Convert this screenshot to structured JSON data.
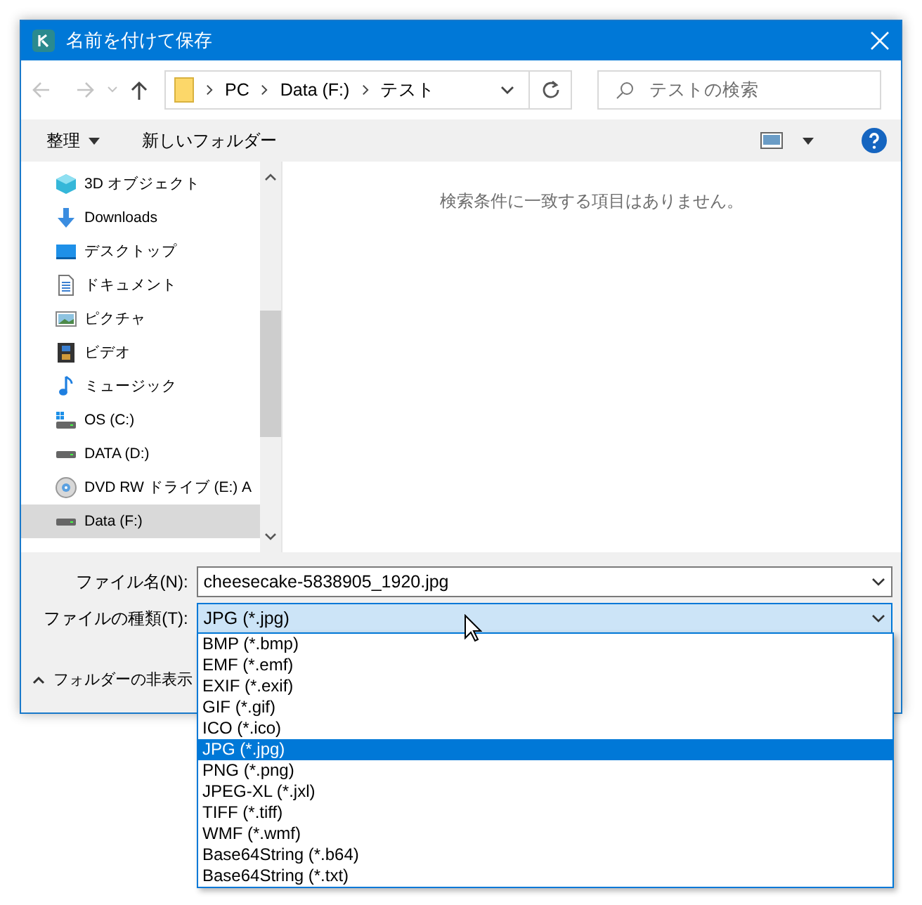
{
  "window": {
    "title": "名前を付けて保存"
  },
  "address": {
    "path": [
      {
        "label": "PC"
      },
      {
        "label": "Data (F:)"
      },
      {
        "label": "テスト"
      }
    ]
  },
  "search": {
    "placeholder": "テストの検索"
  },
  "toolbar": {
    "organize": "整理",
    "new_folder": "新しいフォルダー"
  },
  "sidebar": {
    "items": [
      {
        "label": "3D オブジェクト",
        "kind": "objects",
        "selected": false
      },
      {
        "label": "Downloads",
        "kind": "downloads",
        "selected": false
      },
      {
        "label": "デスクトップ",
        "kind": "desktop",
        "selected": false
      },
      {
        "label": "ドキュメント",
        "kind": "documents",
        "selected": false
      },
      {
        "label": "ピクチャ",
        "kind": "pictures",
        "selected": false
      },
      {
        "label": "ビデオ",
        "kind": "videos",
        "selected": false
      },
      {
        "label": "ミュージック",
        "kind": "music",
        "selected": false
      },
      {
        "label": "OS (C:)",
        "kind": "os-drive",
        "selected": false
      },
      {
        "label": "DATA (D:)",
        "kind": "drive",
        "selected": false
      },
      {
        "label": "DVD RW ドライブ (E:) A",
        "kind": "dvd",
        "selected": false
      },
      {
        "label": "Data (F:)",
        "kind": "drive",
        "selected": true
      }
    ]
  },
  "content": {
    "empty_message": "検索条件に一致する項目はありません。"
  },
  "form": {
    "file_name_label": "ファイル名(N):",
    "file_name": "cheesecake-5838905_1920.jpg",
    "file_type_label": "ファイルの種類(T):",
    "file_type": "JPG (*.jpg)",
    "hide_folders": "フォルダーの非表示"
  },
  "file_type_options": [
    {
      "label": "BMP (*.bmp)",
      "selected": false
    },
    {
      "label": "EMF (*.emf)",
      "selected": false
    },
    {
      "label": "EXIF (*.exif)",
      "selected": false
    },
    {
      "label": "GIF (*.gif)",
      "selected": false
    },
    {
      "label": "ICO (*.ico)",
      "selected": false
    },
    {
      "label": "JPG (*.jpg)",
      "selected": true
    },
    {
      "label": "PNG (*.png)",
      "selected": false
    },
    {
      "label": "JPEG-XL (*.jxl)",
      "selected": false
    },
    {
      "label": "TIFF (*.tiff)",
      "selected": false
    },
    {
      "label": "WMF (*.wmf)",
      "selected": false
    },
    {
      "label": "Base64String (*.b64)",
      "selected": false
    },
    {
      "label": "Base64String (*.txt)",
      "selected": false
    }
  ]
}
